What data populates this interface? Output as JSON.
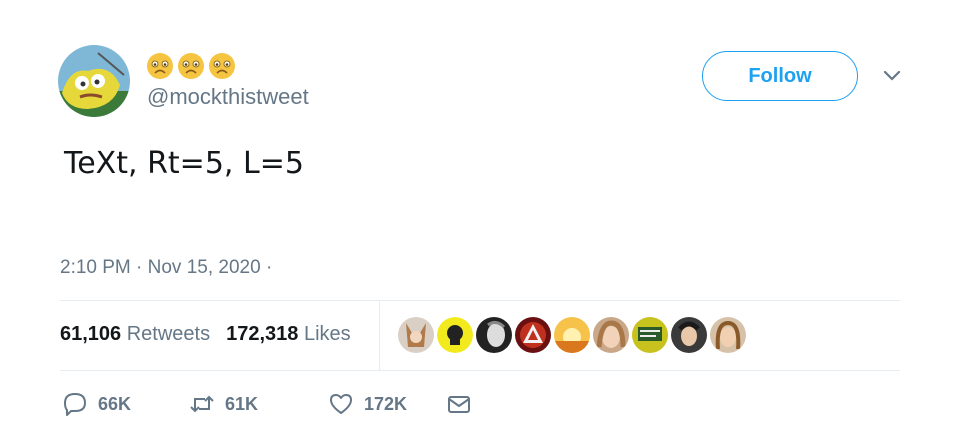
{
  "user": {
    "name_emojis": [
      "worried-face",
      "worried-face",
      "worried-face"
    ],
    "handle": "@mockthistweet"
  },
  "follow_button": {
    "label": "Follow"
  },
  "tweet": {
    "text": "TeXt, Rt=5, L=5",
    "timestamp": "2:10 PM · Nov 15, 2020 ·"
  },
  "stats": {
    "retweets_count": "61,106",
    "retweets_label": "Retweets",
    "likes_count": "172,318",
    "likes_label": "Likes"
  },
  "liked_by_avatars": [
    "liker-1",
    "liker-2",
    "liker-3",
    "liker-4",
    "liker-5",
    "liker-6",
    "liker-7",
    "liker-8",
    "liker-9"
  ],
  "actions": {
    "reply_count": "66K",
    "retweet_count": "61K",
    "like_count": "172K"
  },
  "colors": {
    "accent": "#1da1f2",
    "secondary_text": "#657786",
    "divider": "#e6ecf0"
  }
}
